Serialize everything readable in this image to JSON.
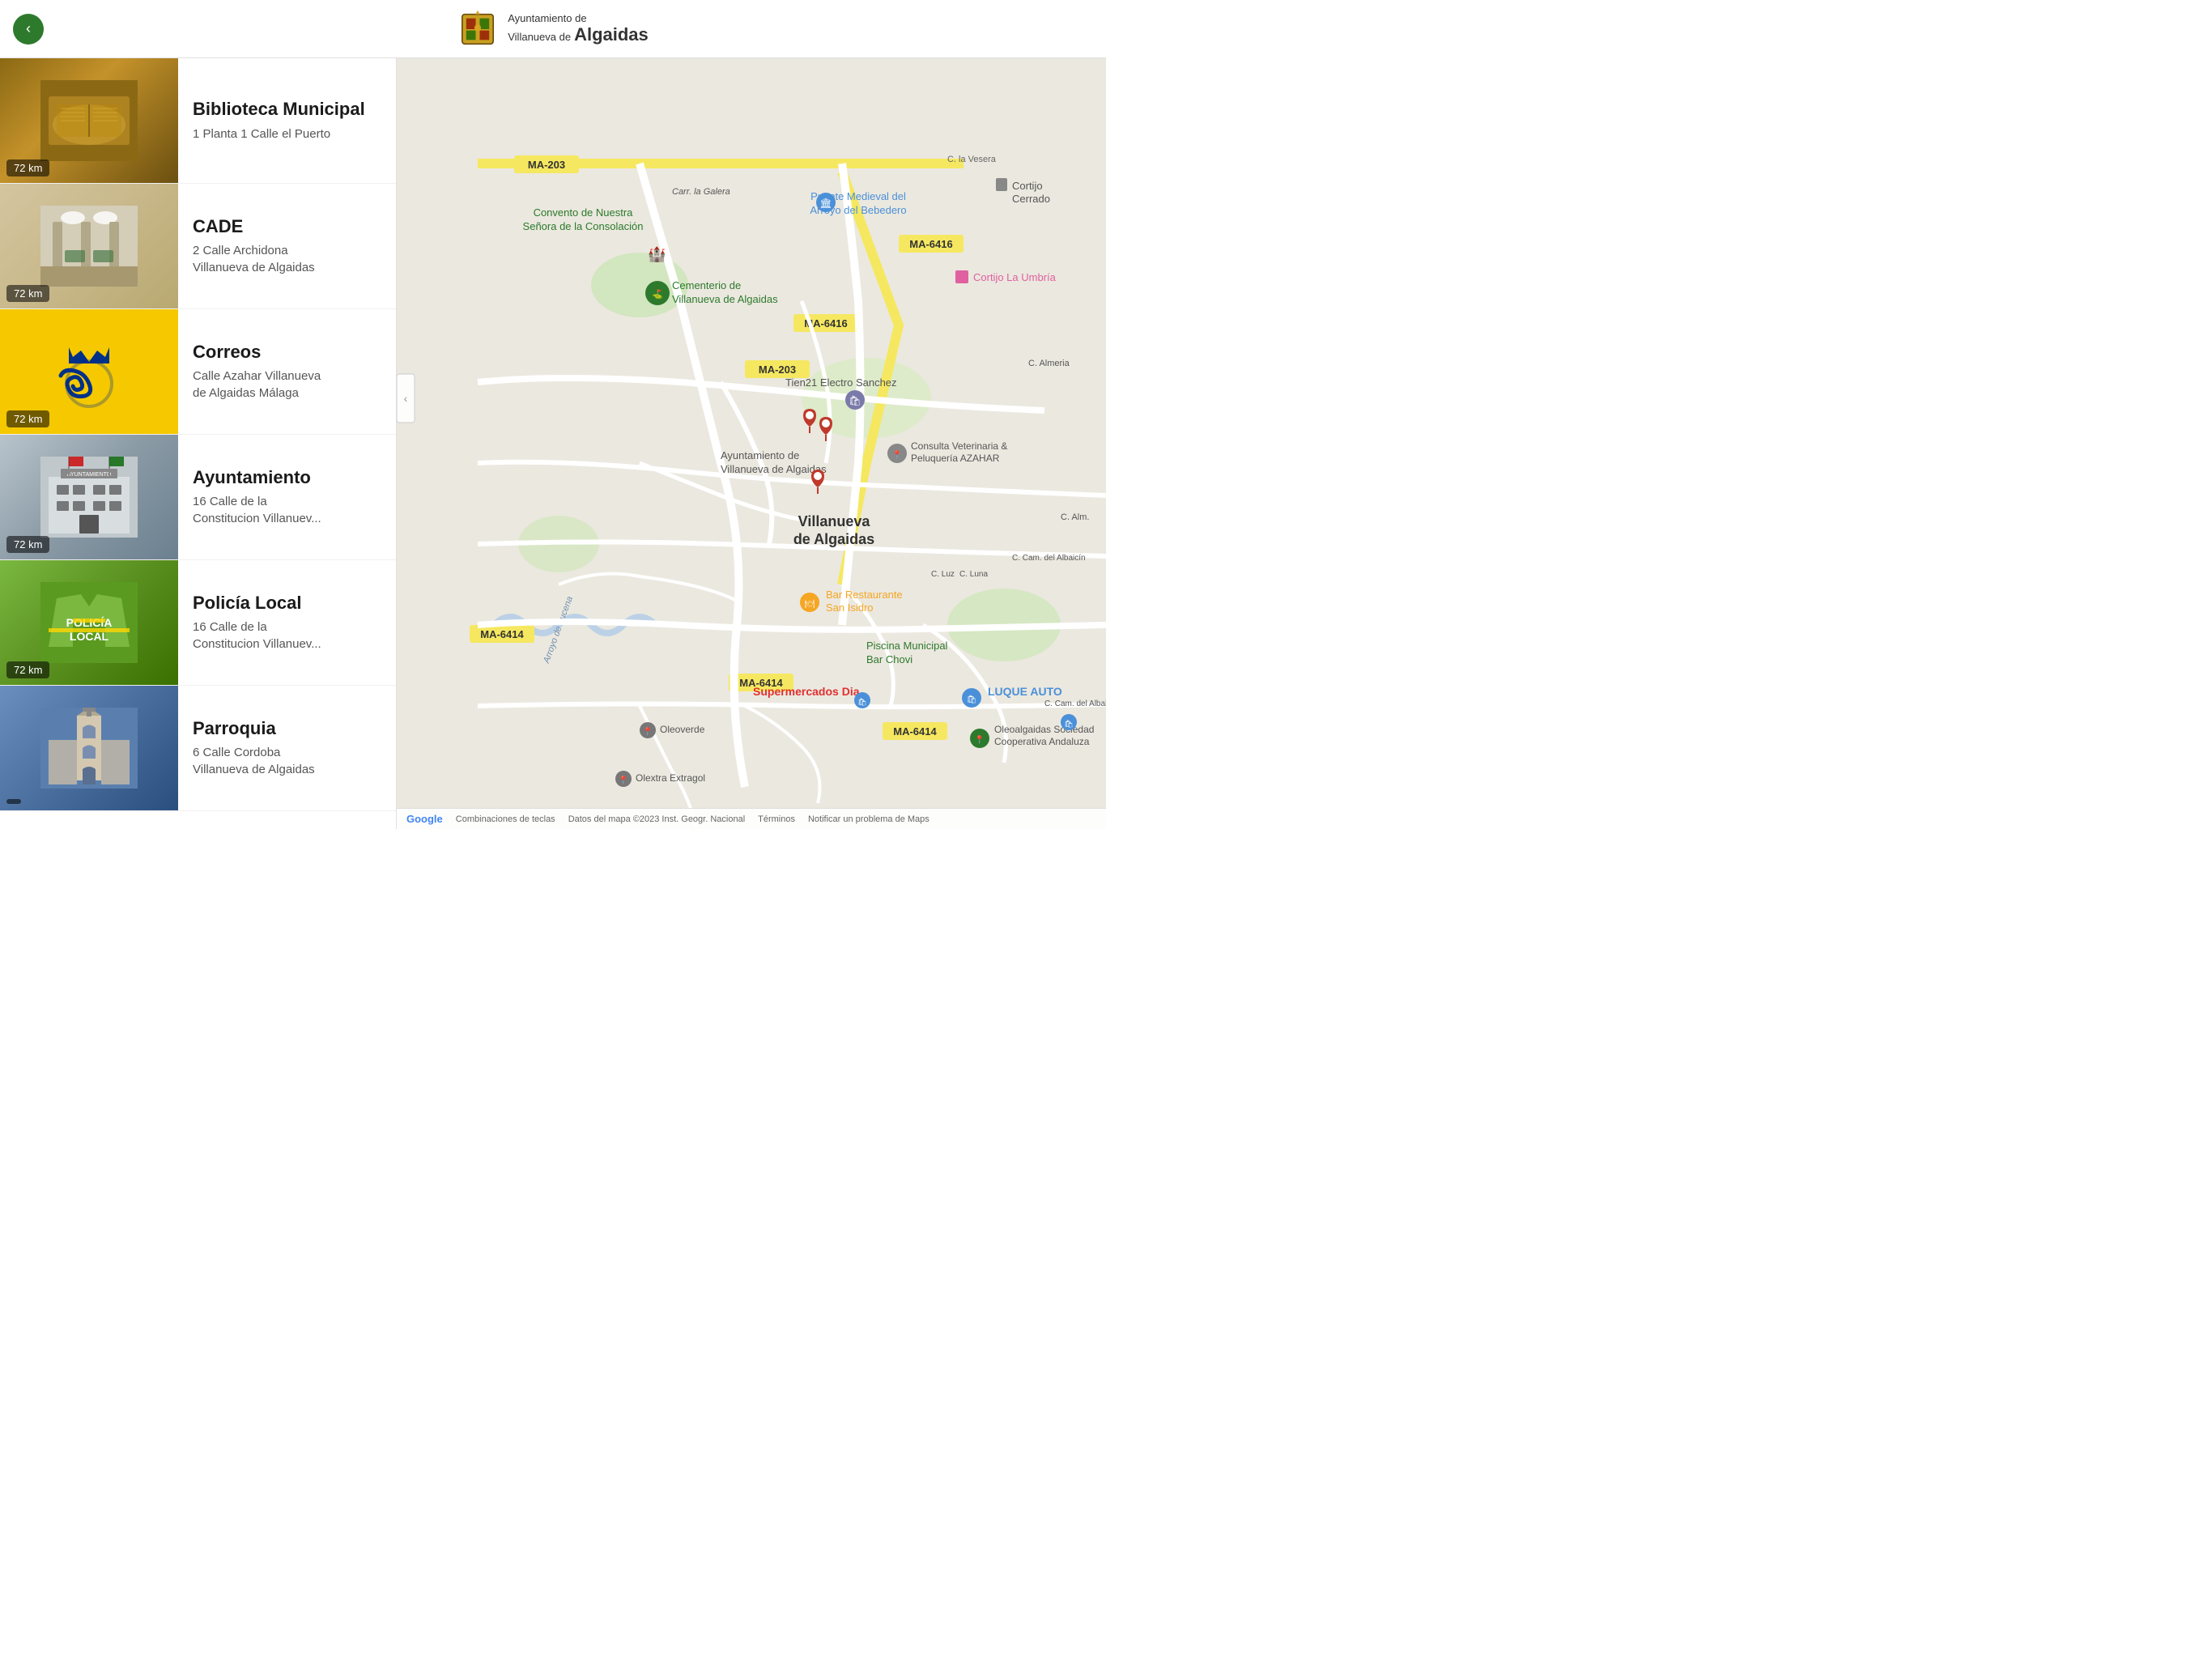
{
  "header": {
    "back_label": "‹",
    "brand_line1": "Ayuntamiento de",
    "brand_line2": "Villanueva de",
    "brand_line3": "Algaidas"
  },
  "list": {
    "items": [
      {
        "id": "biblioteca",
        "name": "Biblioteca Municipal",
        "address_line1": "1 Planta 1 Calle el Puerto",
        "address_line2": "",
        "distance": "72 km",
        "image_type": "biblioteca"
      },
      {
        "id": "cade",
        "name": "CADE",
        "address_line1": "2 Calle Archidona",
        "address_line2": "Villanueva de Algaidas",
        "distance": "72 km",
        "image_type": "cade"
      },
      {
        "id": "correos",
        "name": "Correos",
        "address_line1": "Calle Azahar Villanueva",
        "address_line2": "de Algaidas Málaga",
        "distance": "72 km",
        "image_type": "correos"
      },
      {
        "id": "ayuntamiento",
        "name": "Ayuntamiento",
        "address_line1": "16 Calle de la",
        "address_line2": "Constitucion Villanuev...",
        "distance": "72 km",
        "image_type": "ayuntamiento"
      },
      {
        "id": "policia",
        "name": "Policía Local",
        "address_line1": "16 Calle de la",
        "address_line2": "Constitucion Villanuev...",
        "distance": "72 km",
        "image_type": "policia"
      },
      {
        "id": "parroquia",
        "name": "Parroquia",
        "address_line1": "6 Calle Cordoba",
        "address_line2": "Villanueva de Algaidas",
        "distance": "",
        "image_type": "parroquia"
      }
    ]
  },
  "map": {
    "attribution": "Google",
    "keyboard_shortcuts": "Combinaciones de teclas",
    "map_data": "Datos del mapa ©2023 Inst. Geogr. Nacional",
    "terms": "Términos",
    "report_problem": "Notificar un problema de Maps"
  }
}
